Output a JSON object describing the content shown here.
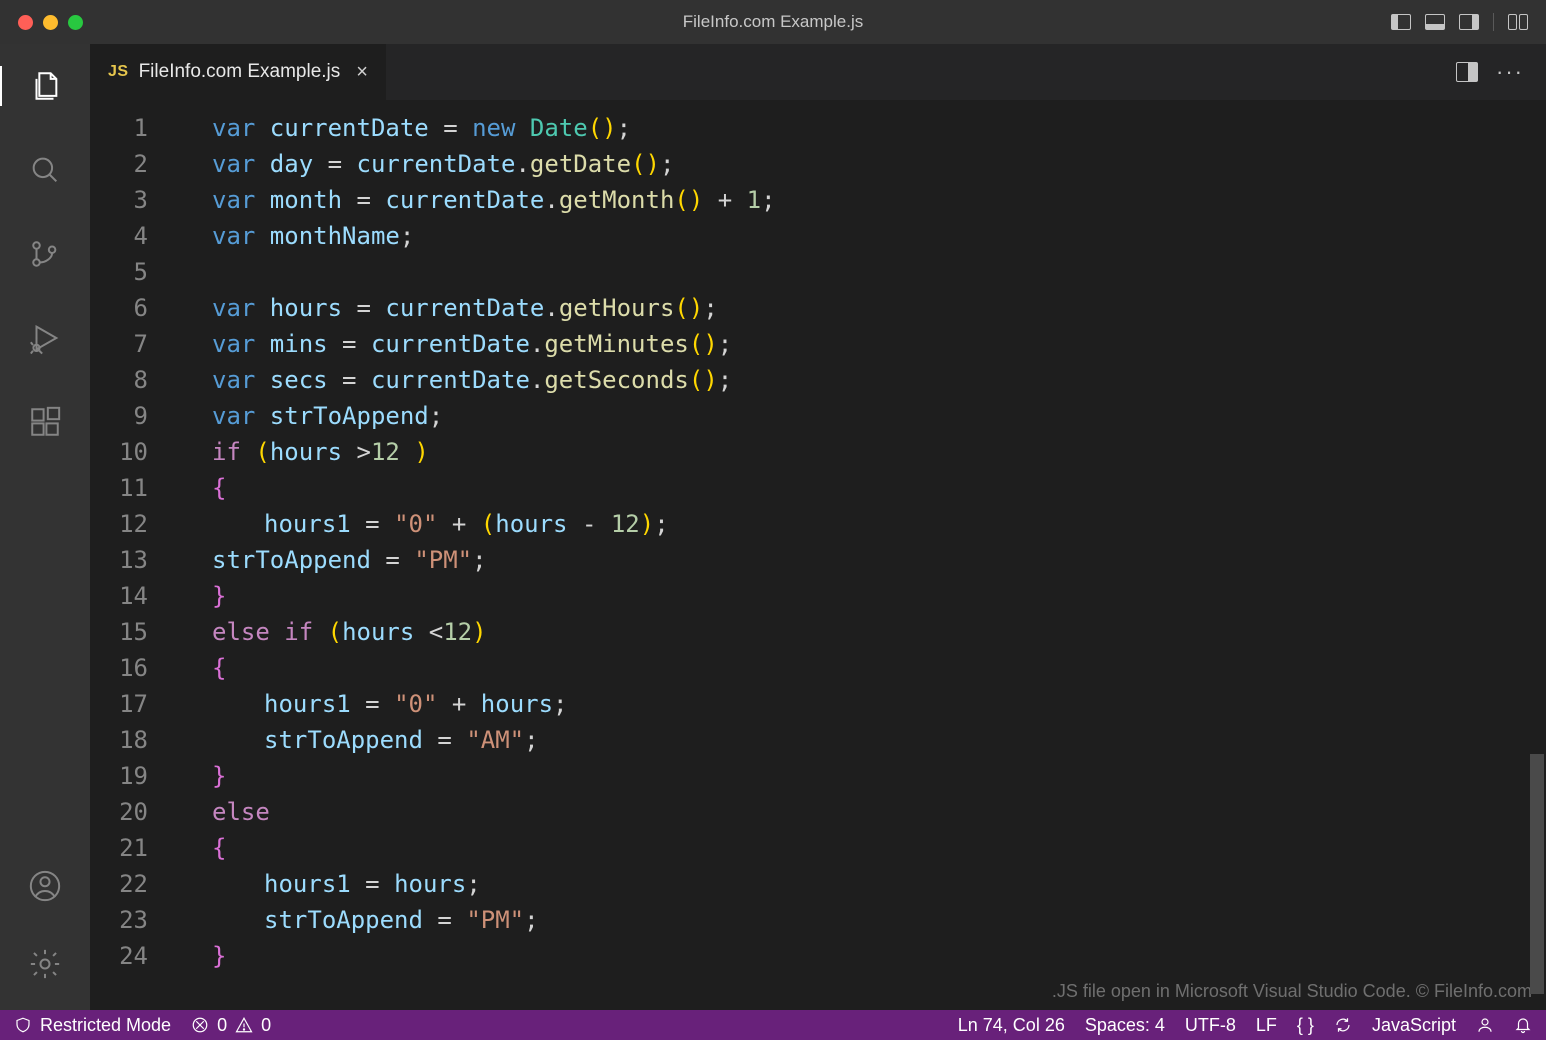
{
  "window": {
    "title": "FileInfo.com Example.js"
  },
  "tab": {
    "badge": "JS",
    "filename": "FileInfo.com Example.js"
  },
  "watermark": ".JS file open in Microsoft Visual Studio Code. © FileInfo.com",
  "statusbar": {
    "restrictedMode": "Restricted Mode",
    "errors": "0",
    "warnings": "0",
    "cursor": "Ln 74, Col 26",
    "spaces": "Spaces: 4",
    "encoding": "UTF-8",
    "eol": "LF",
    "curly": "{ }",
    "language": "JavaScript"
  },
  "code": {
    "lines": [
      {
        "n": 1,
        "tokens": [
          [
            "kw",
            "var "
          ],
          [
            "id",
            "currentDate"
          ],
          [
            "pn",
            " "
          ],
          [
            "op",
            "="
          ],
          [
            "pn",
            " "
          ],
          [
            "kw",
            "new "
          ],
          [
            "cls",
            "Date"
          ],
          [
            "par-y",
            "("
          ],
          [
            "par-y",
            ")"
          ],
          [
            "pn",
            ";"
          ]
        ]
      },
      {
        "n": 2,
        "tokens": [
          [
            "kw",
            "var "
          ],
          [
            "id",
            "day"
          ],
          [
            "pn",
            " "
          ],
          [
            "op",
            "="
          ],
          [
            "pn",
            " "
          ],
          [
            "id",
            "currentDate"
          ],
          [
            "pn",
            "."
          ],
          [
            "fn",
            "getDate"
          ],
          [
            "par-y",
            "("
          ],
          [
            "par-y",
            ")"
          ],
          [
            "pn",
            ";"
          ]
        ]
      },
      {
        "n": 3,
        "tokens": [
          [
            "kw",
            "var "
          ],
          [
            "id",
            "month"
          ],
          [
            "pn",
            " "
          ],
          [
            "op",
            "="
          ],
          [
            "pn",
            " "
          ],
          [
            "id",
            "currentDate"
          ],
          [
            "pn",
            "."
          ],
          [
            "fn",
            "getMonth"
          ],
          [
            "par-y",
            "("
          ],
          [
            "par-y",
            ")"
          ],
          [
            "pn",
            " "
          ],
          [
            "op",
            "+"
          ],
          [
            "pn",
            " "
          ],
          [
            "num",
            "1"
          ],
          [
            "pn",
            ";"
          ]
        ]
      },
      {
        "n": 4,
        "tokens": [
          [
            "kw",
            "var "
          ],
          [
            "id",
            "monthName"
          ],
          [
            "pn",
            ";"
          ]
        ]
      },
      {
        "n": 5,
        "tokens": []
      },
      {
        "n": 6,
        "tokens": [
          [
            "kw",
            "var "
          ],
          [
            "id",
            "hours"
          ],
          [
            "pn",
            " "
          ],
          [
            "op",
            "="
          ],
          [
            "pn",
            " "
          ],
          [
            "id",
            "currentDate"
          ],
          [
            "pn",
            "."
          ],
          [
            "fn",
            "getHours"
          ],
          [
            "par-y",
            "("
          ],
          [
            "par-y",
            ")"
          ],
          [
            "pn",
            ";"
          ]
        ]
      },
      {
        "n": 7,
        "tokens": [
          [
            "kw",
            "var "
          ],
          [
            "id",
            "mins"
          ],
          [
            "pn",
            " "
          ],
          [
            "op",
            "="
          ],
          [
            "pn",
            " "
          ],
          [
            "id",
            "currentDate"
          ],
          [
            "pn",
            "."
          ],
          [
            "fn",
            "getMinutes"
          ],
          [
            "par-y",
            "("
          ],
          [
            "par-y",
            ")"
          ],
          [
            "pn",
            ";"
          ]
        ]
      },
      {
        "n": 8,
        "tokens": [
          [
            "kw",
            "var "
          ],
          [
            "id",
            "secs"
          ],
          [
            "pn",
            " "
          ],
          [
            "op",
            "="
          ],
          [
            "pn",
            " "
          ],
          [
            "id",
            "currentDate"
          ],
          [
            "pn",
            "."
          ],
          [
            "fn",
            "getSeconds"
          ],
          [
            "par-y",
            "("
          ],
          [
            "par-y",
            ")"
          ],
          [
            "pn",
            ";"
          ]
        ]
      },
      {
        "n": 9,
        "tokens": [
          [
            "kw",
            "var "
          ],
          [
            "id",
            "strToAppend"
          ],
          [
            "pn",
            ";"
          ]
        ]
      },
      {
        "n": 10,
        "tokens": [
          [
            "kw2",
            "if"
          ],
          [
            "pn",
            " "
          ],
          [
            "par-y",
            "("
          ],
          [
            "id",
            "hours"
          ],
          [
            "pn",
            " "
          ],
          [
            "op",
            ">"
          ],
          [
            "num",
            "12"
          ],
          [
            "pn",
            " "
          ],
          [
            "par-y",
            ")"
          ]
        ]
      },
      {
        "n": 11,
        "tokens": [
          [
            "brace",
            "{"
          ]
        ]
      },
      {
        "n": 12,
        "indent": 1,
        "tokens": [
          [
            "id",
            "hours1"
          ],
          [
            "pn",
            " "
          ],
          [
            "op",
            "="
          ],
          [
            "pn",
            " "
          ],
          [
            "str",
            "\"0\""
          ],
          [
            "pn",
            " "
          ],
          [
            "op",
            "+"
          ],
          [
            "pn",
            " "
          ],
          [
            "par-y",
            "("
          ],
          [
            "id",
            "hours"
          ],
          [
            "pn",
            " "
          ],
          [
            "op",
            "-"
          ],
          [
            "pn",
            " "
          ],
          [
            "num",
            "12"
          ],
          [
            "par-y",
            ")"
          ],
          [
            "pn",
            ";"
          ]
        ]
      },
      {
        "n": 13,
        "tokens": [
          [
            "id",
            "strToAppend"
          ],
          [
            "pn",
            " "
          ],
          [
            "op",
            "="
          ],
          [
            "pn",
            " "
          ],
          [
            "str",
            "\"PM\""
          ],
          [
            "pn",
            ";"
          ]
        ]
      },
      {
        "n": 14,
        "tokens": [
          [
            "brace",
            "}"
          ]
        ]
      },
      {
        "n": 15,
        "tokens": [
          [
            "kw2",
            "else"
          ],
          [
            "pn",
            " "
          ],
          [
            "kw2",
            "if"
          ],
          [
            "pn",
            " "
          ],
          [
            "par-y",
            "("
          ],
          [
            "id",
            "hours"
          ],
          [
            "pn",
            " "
          ],
          [
            "op",
            "<"
          ],
          [
            "num",
            "12"
          ],
          [
            "par-y",
            ")"
          ]
        ]
      },
      {
        "n": 16,
        "tokens": [
          [
            "brace",
            "{"
          ]
        ]
      },
      {
        "n": 17,
        "indent": 1,
        "tokens": [
          [
            "id",
            "hours1"
          ],
          [
            "pn",
            " "
          ],
          [
            "op",
            "="
          ],
          [
            "pn",
            " "
          ],
          [
            "str",
            "\"0\""
          ],
          [
            "pn",
            " "
          ],
          [
            "op",
            "+"
          ],
          [
            "pn",
            " "
          ],
          [
            "id",
            "hours"
          ],
          [
            "pn",
            ";"
          ]
        ]
      },
      {
        "n": 18,
        "indent": 1,
        "tokens": [
          [
            "id",
            "strToAppend"
          ],
          [
            "pn",
            " "
          ],
          [
            "op",
            "="
          ],
          [
            "pn",
            " "
          ],
          [
            "str",
            "\"AM\""
          ],
          [
            "pn",
            ";"
          ]
        ]
      },
      {
        "n": 19,
        "tokens": [
          [
            "brace",
            "}"
          ]
        ]
      },
      {
        "n": 20,
        "tokens": [
          [
            "kw2",
            "else"
          ]
        ]
      },
      {
        "n": 21,
        "tokens": [
          [
            "brace",
            "{"
          ]
        ]
      },
      {
        "n": 22,
        "indent": 1,
        "tokens": [
          [
            "id",
            "hours1"
          ],
          [
            "pn",
            " "
          ],
          [
            "op",
            "="
          ],
          [
            "pn",
            " "
          ],
          [
            "id",
            "hours"
          ],
          [
            "pn",
            ";"
          ]
        ]
      },
      {
        "n": 23,
        "indent": 1,
        "tokens": [
          [
            "id",
            "strToAppend"
          ],
          [
            "pn",
            " "
          ],
          [
            "op",
            "="
          ],
          [
            "pn",
            " "
          ],
          [
            "str",
            "\"PM\""
          ],
          [
            "pn",
            ";"
          ]
        ]
      },
      {
        "n": 24,
        "tokens": [
          [
            "brace",
            "}"
          ]
        ]
      }
    ]
  },
  "scrollbar": {
    "thumbTop": 654,
    "thumbHeight": 240
  }
}
